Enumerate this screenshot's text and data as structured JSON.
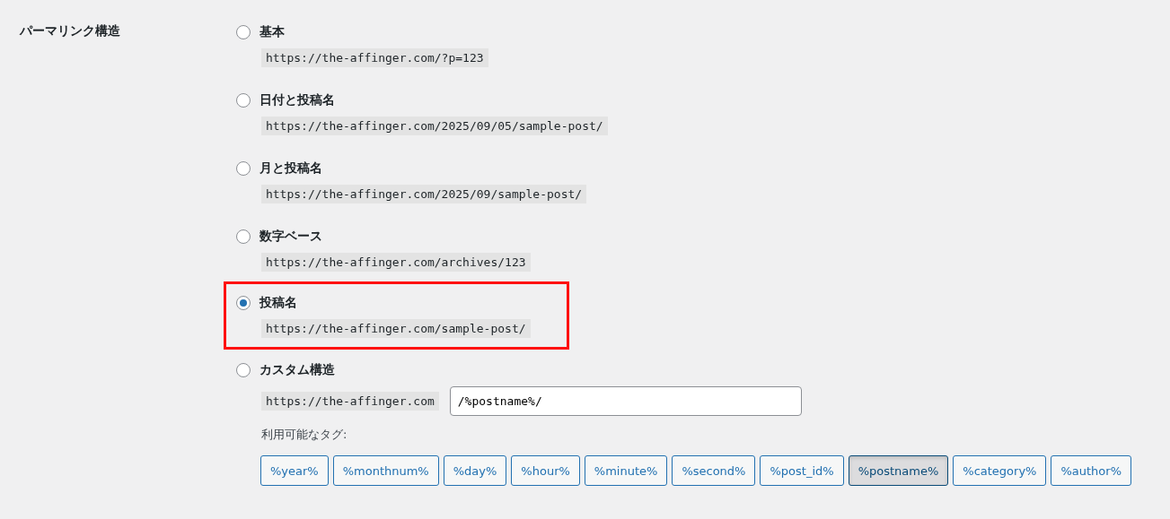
{
  "setting": {
    "label": "パーマリンク構造"
  },
  "options": [
    {
      "label": "基本",
      "url": "https://the-affinger.com/?p=123",
      "selected": false,
      "highlighted": false
    },
    {
      "label": "日付と投稿名",
      "url": "https://the-affinger.com/2025/09/05/sample-post/",
      "selected": false,
      "highlighted": false
    },
    {
      "label": "月と投稿名",
      "url": "https://the-affinger.com/2025/09/sample-post/",
      "selected": false,
      "highlighted": false
    },
    {
      "label": "数字ベース",
      "url": "https://the-affinger.com/archives/123",
      "selected": false,
      "highlighted": false
    },
    {
      "label": "投稿名",
      "url": "https://the-affinger.com/sample-post/",
      "selected": true,
      "highlighted": true
    }
  ],
  "custom": {
    "label": "カスタム構造",
    "selected": false,
    "base": "https://the-affinger.com",
    "value": "/%postname%/",
    "tags_label": "利用可能なタグ:",
    "tags": [
      {
        "label": "%year%",
        "selected": false
      },
      {
        "label": "%monthnum%",
        "selected": false
      },
      {
        "label": "%day%",
        "selected": false
      },
      {
        "label": "%hour%",
        "selected": false
      },
      {
        "label": "%minute%",
        "selected": false
      },
      {
        "label": "%second%",
        "selected": false
      },
      {
        "label": "%post_id%",
        "selected": false
      },
      {
        "label": "%postname%",
        "selected": true
      },
      {
        "label": "%category%",
        "selected": false
      },
      {
        "label": "%author%",
        "selected": false
      }
    ]
  }
}
